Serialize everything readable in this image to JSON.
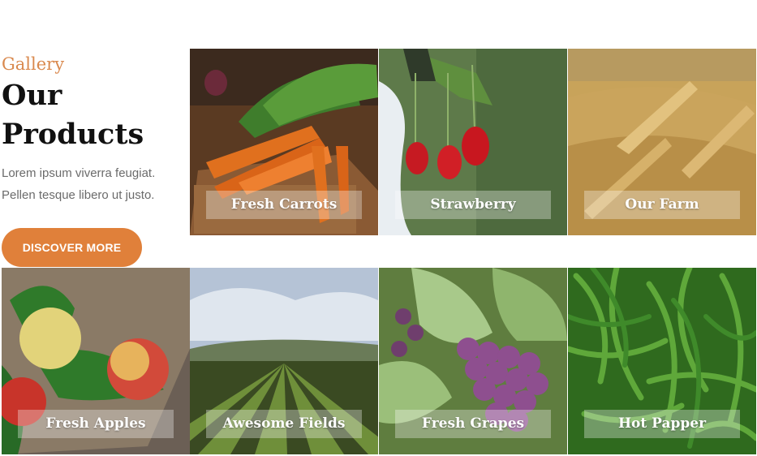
{
  "gallery": {
    "eyebrow": "Gallery",
    "title_line1": "Our",
    "title_line2": "Products",
    "desc_line1": "Lorem ipsum viverra feugiat.",
    "desc_line2": "Pellen tesque libero ut justo.",
    "cta_label": "DISCOVER MORE"
  },
  "tiles": [
    {
      "caption": "Fresh Carrots"
    },
    {
      "caption": "Strawberry"
    },
    {
      "caption": "Our Farm"
    },
    {
      "caption": "Fresh Apples"
    },
    {
      "caption": "Awesome Fields"
    },
    {
      "caption": "Fresh Grapes"
    },
    {
      "caption": "Hot Papper"
    }
  ],
  "colors": {
    "accent": "#e0803a",
    "eyebrow": "#d9894e",
    "title": "#111111",
    "body_text": "#6b6b6b"
  }
}
